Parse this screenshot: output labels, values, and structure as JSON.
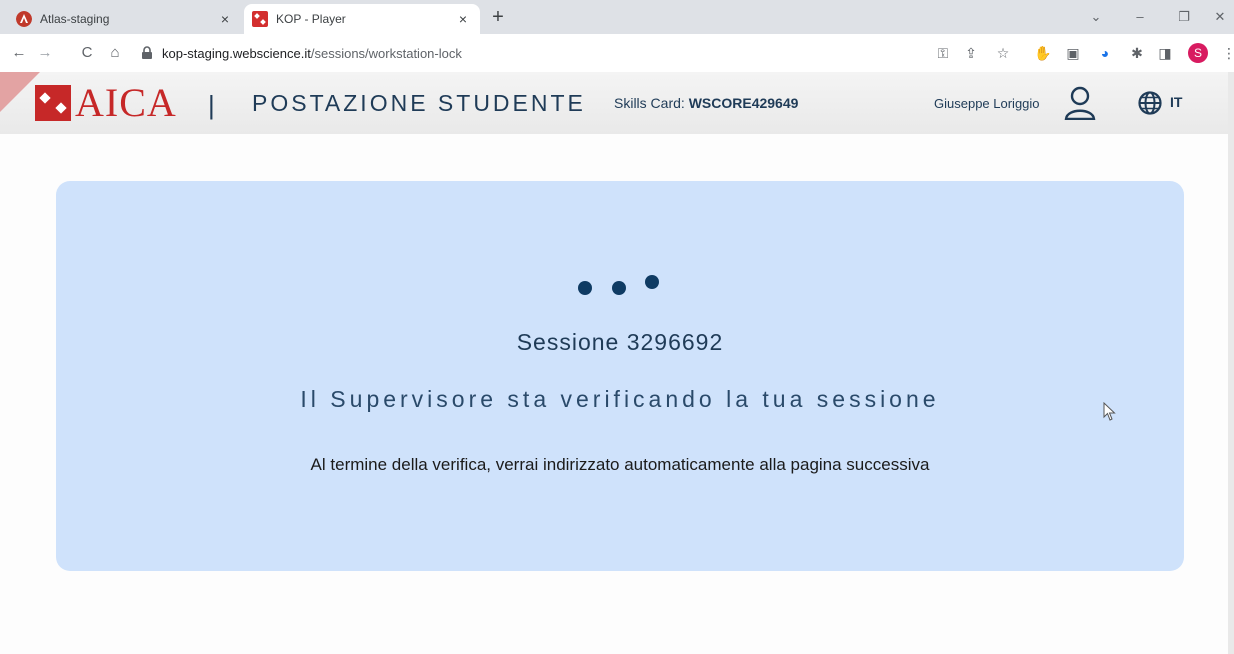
{
  "browser": {
    "tabs": [
      {
        "title": "Atlas-staging",
        "close": "×",
        "favicon_color": "#c0392b"
      },
      {
        "title": "KOP - Player",
        "close": "×",
        "favicon_color": "#d32f2f"
      }
    ],
    "new_tab": "+",
    "window_controls": {
      "dropdown": "⌄",
      "minimize": "–",
      "restore": "❐",
      "close": "✕"
    },
    "nav": {
      "back": "←",
      "forward": "→",
      "reload": "C",
      "home": "⌂"
    },
    "url_host": "kop-staging.webscience.it",
    "url_path": "/sessions/workstation-lock",
    "profile_initial": "S"
  },
  "header": {
    "logo_text": "AICA",
    "divider": "|",
    "station_title": "POSTAZIONE STUDENTE",
    "skills_label": "Skills Card: ",
    "skills_value": "WSCORE429649",
    "user_name": "Giuseppe Loriggio",
    "language": "IT"
  },
  "card": {
    "session_title": "Sessione 3296692",
    "status_text": "Il Supervisore sta verificando la tua sessione",
    "info_text": "Al termine della verifica, verrai indirizzato automaticamente alla pagina successiva"
  },
  "colors": {
    "brand_red": "#c62828",
    "navy": "#1f3b57",
    "card_bg": "#cfe2fb",
    "dot": "#0f3b63"
  }
}
